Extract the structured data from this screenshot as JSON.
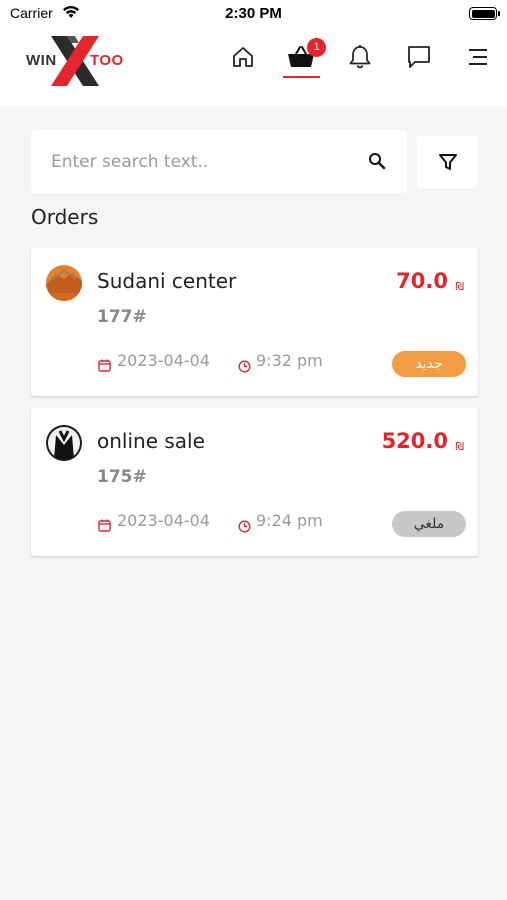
{
  "status_bar": {
    "carrier": "Carrier",
    "time": "2:30 PM"
  },
  "header": {
    "logo_left": "WIN",
    "logo_right": "TOO",
    "cart_badge": "1",
    "accent_color": "#e4262c"
  },
  "search": {
    "placeholder": "Enter search text.."
  },
  "orders_title": "Orders",
  "orders": [
    {
      "customer": "Sudani center",
      "order_no": "177#",
      "price": "70.0",
      "currency": "₪",
      "date": "2023-04-04",
      "time": "9:32 pm",
      "status": "جديد",
      "status_color": "#f29c43"
    },
    {
      "customer": "online sale",
      "order_no": "175#",
      "price": "520.0",
      "currency": "₪",
      "date": "2023-04-04",
      "time": "9:24 pm",
      "status": "ملغي",
      "status_color": "#c7c7c7"
    }
  ]
}
